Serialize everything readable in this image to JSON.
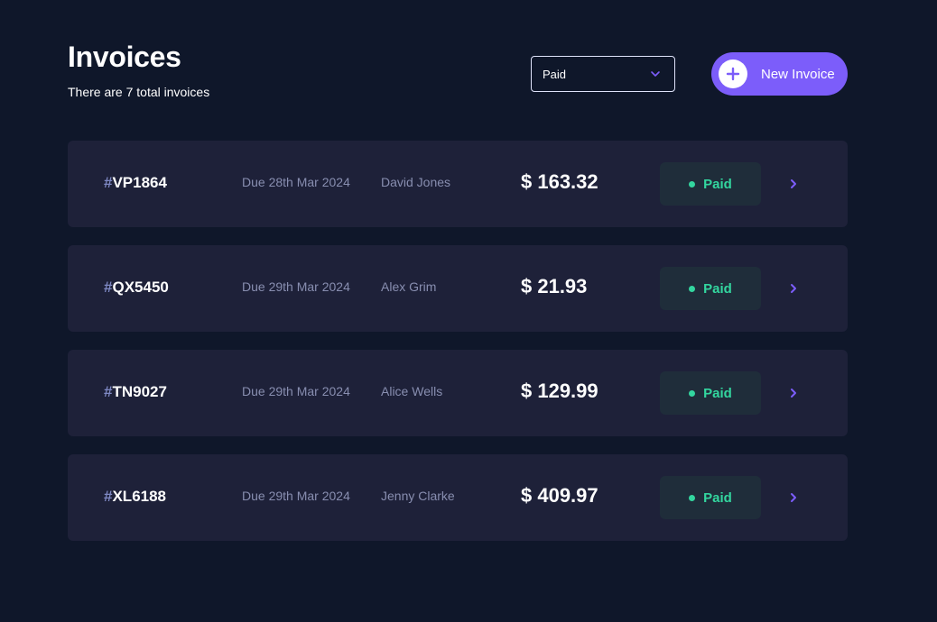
{
  "header": {
    "title": "Invoices",
    "subtitle": "There are 7 total invoices"
  },
  "filter": {
    "selected": "Paid",
    "icon": "chevron-down-icon"
  },
  "new_invoice": {
    "label": "New Invoice",
    "icon": "plus-icon"
  },
  "invoices": [
    {
      "hash": "#",
      "id": "VP1864",
      "due": "Due 28th Mar 2024",
      "client": "David Jones",
      "amount": "$ 163.32",
      "status": "Paid"
    },
    {
      "hash": "#",
      "id": "QX5450",
      "due": "Due 29th Mar 2024",
      "client": "Alex Grim",
      "amount": "$ 21.93",
      "status": "Paid"
    },
    {
      "hash": "#",
      "id": "TN9027",
      "due": "Due 29th Mar 2024",
      "client": "Alice Wells",
      "amount": "$ 129.99",
      "status": "Paid"
    },
    {
      "hash": "#",
      "id": "XL6188",
      "due": "Due 29th Mar 2024",
      "client": "Jenny Clarke",
      "amount": "$ 409.97",
      "status": "Paid"
    }
  ],
  "colors": {
    "background": "#0f172a",
    "row_background": "#1e2139",
    "accent": "#7c5dfa",
    "paid": "#33d69f",
    "muted_text": "#888eb0"
  }
}
